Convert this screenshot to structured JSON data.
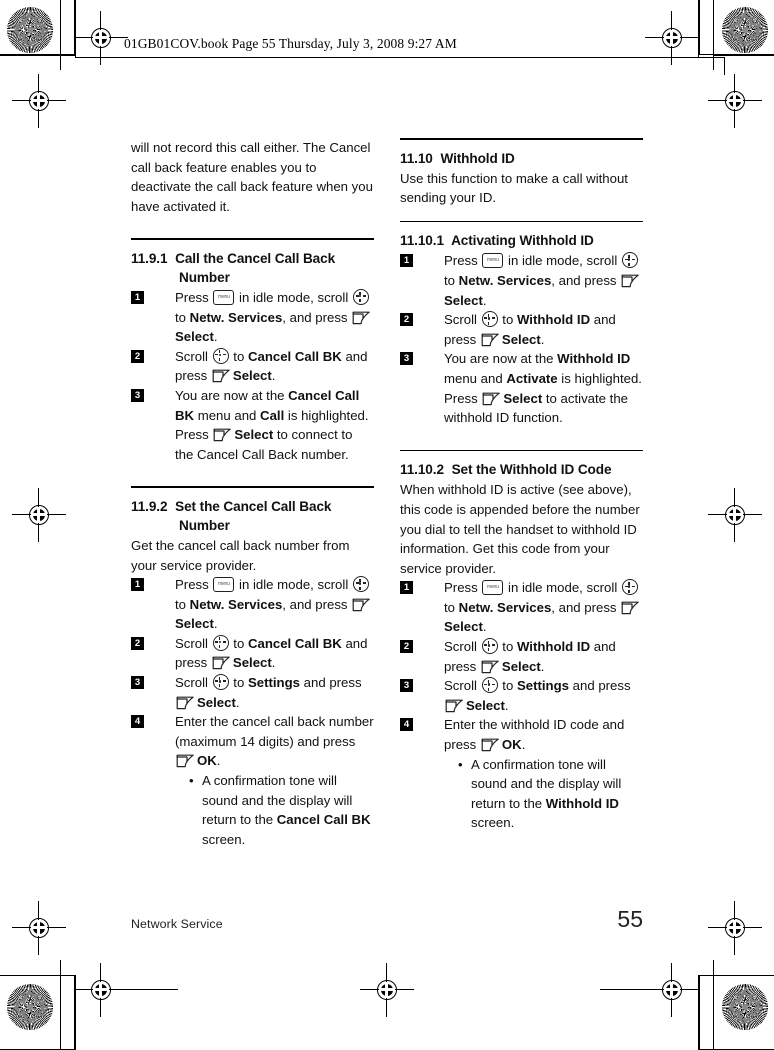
{
  "document": {
    "file_header": "01GB01COV.book  Page 55  Thursday, July 3, 2008  9:27 AM",
    "footer_section": "Network Service",
    "page_number": "55"
  },
  "icons": {
    "menu_key_label": "menu",
    "menu_key": "menu-key-icon",
    "scroll_key": "scroll-navigation-icon",
    "soft_key": "softkey-icon",
    "bullet": "•"
  },
  "left_column": {
    "intro_paragraph": "will not record this call either. The Cancel call back feature enables you to deactivate the call back feature when you have activated it.",
    "sections": [
      {
        "number": "11.9.1",
        "title_line1": "Call the Cancel Call Back",
        "title_line2": "Number",
        "steps": [
          {
            "n": "1",
            "parts": [
              {
                "t": "text",
                "v": "Press "
              },
              {
                "t": "icon",
                "v": "menu"
              },
              {
                "t": "text",
                "v": " in idle mode, scroll "
              },
              {
                "t": "icon",
                "v": "scroll"
              },
              {
                "t": "text",
                "v": " to "
              },
              {
                "t": "bold",
                "v": "Netw. Services"
              },
              {
                "t": "text",
                "v": ", and press "
              },
              {
                "t": "icon",
                "v": "soft"
              },
              {
                "t": "bold",
                "v": "Select"
              },
              {
                "t": "text",
                "v": "."
              }
            ]
          },
          {
            "n": "2",
            "parts": [
              {
                "t": "text",
                "v": "Scroll "
              },
              {
                "t": "icon",
                "v": "scroll"
              },
              {
                "t": "text",
                "v": " to "
              },
              {
                "t": "bold",
                "v": "Cancel Call BK"
              },
              {
                "t": "text",
                "v": " and press "
              },
              {
                "t": "icon",
                "v": "soft"
              },
              {
                "t": "bold",
                "v": "Select"
              },
              {
                "t": "text",
                "v": "."
              }
            ]
          },
          {
            "n": "3",
            "parts": [
              {
                "t": "text",
                "v": "You are now at the "
              },
              {
                "t": "bold",
                "v": "Cancel Call BK"
              },
              {
                "t": "text",
                "v": " menu and "
              },
              {
                "t": "bold",
                "v": "Call"
              },
              {
                "t": "text",
                "v": " is highlighted. Press "
              },
              {
                "t": "icon",
                "v": "soft"
              },
              {
                "t": "bold",
                "v": "Select"
              },
              {
                "t": "text",
                "v": " to connect to the Cancel Call Back number."
              }
            ]
          }
        ]
      },
      {
        "number": "11.9.2",
        "title_line1": "Set the Cancel Call Back",
        "title_line2": "Number",
        "lead_paragraph": "Get the cancel call back number from your service provider.",
        "steps": [
          {
            "n": "1",
            "parts": [
              {
                "t": "text",
                "v": "Press "
              },
              {
                "t": "icon",
                "v": "menu"
              },
              {
                "t": "text",
                "v": " in idle mode, scroll "
              },
              {
                "t": "icon",
                "v": "scroll"
              },
              {
                "t": "text",
                "v": " to "
              },
              {
                "t": "bold",
                "v": "Netw. Services"
              },
              {
                "t": "text",
                "v": ", and press "
              },
              {
                "t": "icon",
                "v": "soft"
              },
              {
                "t": "bold",
                "v": "Select"
              },
              {
                "t": "text",
                "v": "."
              }
            ]
          },
          {
            "n": "2",
            "parts": [
              {
                "t": "text",
                "v": "Scroll "
              },
              {
                "t": "icon",
                "v": "scroll"
              },
              {
                "t": "text",
                "v": " to "
              },
              {
                "t": "bold",
                "v": "Cancel Call BK"
              },
              {
                "t": "text",
                "v": " and press "
              },
              {
                "t": "icon",
                "v": "soft"
              },
              {
                "t": "bold",
                "v": "Select"
              },
              {
                "t": "text",
                "v": "."
              }
            ]
          },
          {
            "n": "3",
            "parts": [
              {
                "t": "text",
                "v": "Scroll "
              },
              {
                "t": "icon",
                "v": "scroll"
              },
              {
                "t": "text",
                "v": " to "
              },
              {
                "t": "bold",
                "v": "Settings"
              },
              {
                "t": "text",
                "v": " and press "
              },
              {
                "t": "icon",
                "v": "soft"
              },
              {
                "t": "bold",
                "v": "Select"
              },
              {
                "t": "text",
                "v": "."
              }
            ]
          },
          {
            "n": "4",
            "parts": [
              {
                "t": "text",
                "v": "Enter the cancel call back number (maximum 14 digits) and press "
              },
              {
                "t": "icon",
                "v": "soft"
              },
              {
                "t": "bold",
                "v": "OK"
              },
              {
                "t": "text",
                "v": "."
              }
            ],
            "sub_bullets": [
              [
                {
                  "t": "text",
                  "v": "A confirmation tone will sound and the display will return to the "
                },
                {
                  "t": "bold",
                  "v": "Cancel Call BK"
                },
                {
                  "t": "text",
                  "v": " screen."
                }
              ]
            ]
          }
        ]
      }
    ]
  },
  "right_column": {
    "sections": [
      {
        "number": "11.10",
        "title_line1": "Withhold ID",
        "lead_paragraph": "Use this function to make a call without sending your ID.",
        "steps": []
      },
      {
        "number": "11.10.1",
        "title_line1": "Activating Withhold ID",
        "steps": [
          {
            "n": "1",
            "parts": [
              {
                "t": "text",
                "v": "Press "
              },
              {
                "t": "icon",
                "v": "menu"
              },
              {
                "t": "text",
                "v": " in idle mode, scroll "
              },
              {
                "t": "icon",
                "v": "scroll"
              },
              {
                "t": "text",
                "v": " to "
              },
              {
                "t": "bold",
                "v": "Netw. Services"
              },
              {
                "t": "text",
                "v": ", and press "
              },
              {
                "t": "icon",
                "v": "soft"
              },
              {
                "t": "bold",
                "v": "Select"
              },
              {
                "t": "text",
                "v": "."
              }
            ]
          },
          {
            "n": "2",
            "parts": [
              {
                "t": "text",
                "v": "Scroll "
              },
              {
                "t": "icon",
                "v": "scroll"
              },
              {
                "t": "text",
                "v": " to "
              },
              {
                "t": "bold",
                "v": "Withhold ID"
              },
              {
                "t": "text",
                "v": " and press "
              },
              {
                "t": "icon",
                "v": "soft"
              },
              {
                "t": "bold",
                "v": "Select"
              },
              {
                "t": "text",
                "v": "."
              }
            ]
          },
          {
            "n": "3",
            "parts": [
              {
                "t": "text",
                "v": "You are now at the "
              },
              {
                "t": "bold",
                "v": "Withhold ID"
              },
              {
                "t": "text",
                "v": " menu and "
              },
              {
                "t": "bold",
                "v": "Activate"
              },
              {
                "t": "text",
                "v": " is highlighted. Press "
              },
              {
                "t": "icon",
                "v": "soft"
              },
              {
                "t": "bold",
                "v": "Select"
              },
              {
                "t": "text",
                "v": " to activate the withhold ID function."
              }
            ]
          }
        ]
      },
      {
        "number": "11.10.2",
        "title_line1": "Set the Withhold ID Code",
        "lead_paragraph": "When withhold ID is active (see above), this code is appended before the number you dial to tell the handset to withhold ID information. Get this code from your service provider.",
        "steps": [
          {
            "n": "1",
            "parts": [
              {
                "t": "text",
                "v": "Press "
              },
              {
                "t": "icon",
                "v": "menu"
              },
              {
                "t": "text",
                "v": " in idle mode, scroll "
              },
              {
                "t": "icon",
                "v": "scroll"
              },
              {
                "t": "text",
                "v": " to "
              },
              {
                "t": "bold",
                "v": "Netw. Services"
              },
              {
                "t": "text",
                "v": ", and press "
              },
              {
                "t": "icon",
                "v": "soft"
              },
              {
                "t": "bold",
                "v": "Select"
              },
              {
                "t": "text",
                "v": "."
              }
            ]
          },
          {
            "n": "2",
            "parts": [
              {
                "t": "text",
                "v": "Scroll "
              },
              {
                "t": "icon",
                "v": "scroll"
              },
              {
                "t": "text",
                "v": " to "
              },
              {
                "t": "bold",
                "v": "Withhold ID"
              },
              {
                "t": "text",
                "v": " and press "
              },
              {
                "t": "icon",
                "v": "soft"
              },
              {
                "t": "bold",
                "v": "Select"
              },
              {
                "t": "text",
                "v": "."
              }
            ]
          },
          {
            "n": "3",
            "parts": [
              {
                "t": "text",
                "v": "Scroll "
              },
              {
                "t": "icon",
                "v": "scroll"
              },
              {
                "t": "text",
                "v": " to "
              },
              {
                "t": "bold",
                "v": "Settings"
              },
              {
                "t": "text",
                "v": " and press "
              },
              {
                "t": "icon",
                "v": "soft"
              },
              {
                "t": "bold",
                "v": "Select"
              },
              {
                "t": "text",
                "v": "."
              }
            ]
          },
          {
            "n": "4",
            "parts": [
              {
                "t": "text",
                "v": "Enter the withhold ID code and press "
              },
              {
                "t": "icon",
                "v": "soft"
              },
              {
                "t": "bold",
                "v": "OK"
              },
              {
                "t": "text",
                "v": "."
              }
            ],
            "sub_bullets": [
              [
                {
                  "t": "text",
                  "v": "A confirmation tone will sound and the display will return to the "
                },
                {
                  "t": "bold",
                  "v": "Withhold ID"
                },
                {
                  "t": "text",
                  "v": " screen."
                }
              ]
            ]
          }
        ]
      }
    ]
  }
}
